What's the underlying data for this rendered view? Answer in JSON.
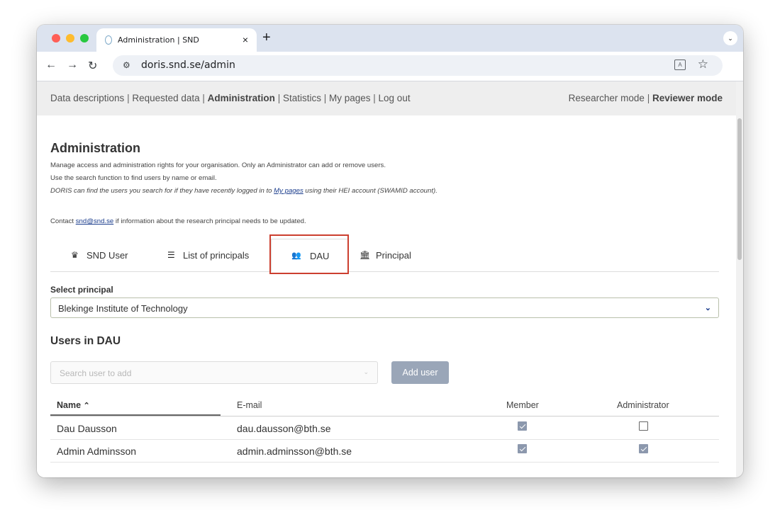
{
  "browser": {
    "tab_title": "Administration | SND",
    "tab_close": "×",
    "new_tab": "+",
    "tab_menu": "⌄",
    "url": "doris.snd.se/admin"
  },
  "topnav": {
    "left": [
      "Data descriptions",
      "Requested data",
      "Administration",
      "Statistics",
      "My pages",
      "Log out"
    ],
    "active_left": "Administration",
    "right": [
      "Researcher mode",
      "Reviewer mode"
    ],
    "active_right": "Reviewer mode",
    "separator": "|"
  },
  "admin": {
    "title": "Administration",
    "line1": "Manage access and administration rights for your organisation. Only an Administrator can add or remove users.",
    "line2": "Use the search function to find users by name or email.",
    "line3_pre": "DORIS can find the users you search for if they have recently logged in to ",
    "line3_link": "My pages",
    "line3_post": " using their HEI account (SWAMID account).",
    "contact_pre": "Contact ",
    "contact_link": "snd@snd.se",
    "contact_post": " if information about the research principal needs to be updated."
  },
  "tabs": [
    {
      "label": "SND User",
      "icon": "crown-icon",
      "glyph": "♛"
    },
    {
      "label": "List of principals",
      "icon": "list-icon",
      "glyph": "☰"
    },
    {
      "label": "DAU",
      "icon": "users-icon",
      "glyph": "👥"
    },
    {
      "label": "Principal",
      "icon": "institution-icon",
      "glyph": "🏛"
    }
  ],
  "active_tab": "DAU",
  "highlight_color": "#cc3f2f",
  "select_principal": {
    "label": "Select principal",
    "value": "Blekinge Institute of Technology"
  },
  "users": {
    "title": "Users in DAU",
    "search_placeholder": "Search user to add",
    "add_button": "Add user",
    "columns": [
      "Name",
      "E-mail",
      "Member",
      "Administrator"
    ],
    "sort_indicator": "^",
    "rows": [
      {
        "name": "Dau Dausson",
        "email": "dau.dausson@bth.se",
        "member": true,
        "administrator": false
      },
      {
        "name": "Admin Adminsson",
        "email": "admin.adminsson@bth.se",
        "member": true,
        "administrator": true
      }
    ]
  },
  "colors": {
    "accent_link": "#1a3c8c",
    "checkbox_checked": "#8c98ad",
    "button_disabled": "#9aa6b8"
  }
}
